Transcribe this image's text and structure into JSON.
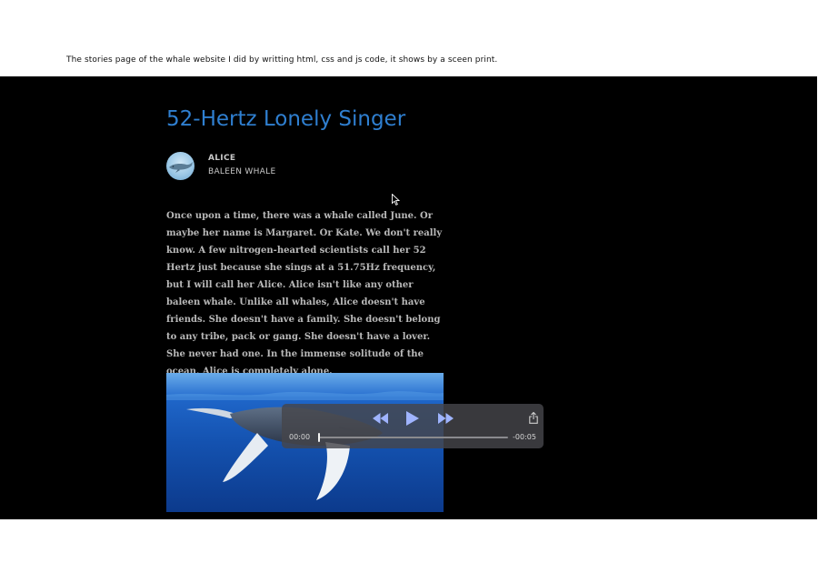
{
  "caption": "The stories page of the whale website I did by writting html, css and js code, it shows by a sceen print.",
  "story": {
    "title": "52-Hertz Lonely Singer",
    "author": {
      "name": "ALICE",
      "species": "BALEEN WHALE",
      "avatar_icon": "whale-avatar-icon"
    },
    "body": "Once upon a time, there was a whale called June. Or maybe her name is Margaret. Or Kate. We don't really know. A few nitrogen-hearted scientists call her 52 Hertz just because she sings at a 51.75Hz frequency, but I will call her Alice. Alice isn't like any other baleen whale. Unlike all whales, Alice doesn't have friends. She doesn't have a family. She doesn't belong to any tribe, pack or gang. She doesn't have a lover. She never had one. In the immense solitude of the ocean, Alice is completely alone.",
    "image_icon": "humpback-whale-image"
  },
  "audio_player": {
    "elapsed": "00:00",
    "remaining": "-00:05",
    "progress": 0,
    "icons": {
      "rewind": "rewind-icon",
      "play": "play-icon",
      "forward": "fast-forward-icon",
      "share": "share-icon"
    }
  },
  "colors": {
    "background": "#000000",
    "title": "#2f7fd0",
    "body_text": "#b9b9b9",
    "player_accent": "#9fb4ff"
  }
}
